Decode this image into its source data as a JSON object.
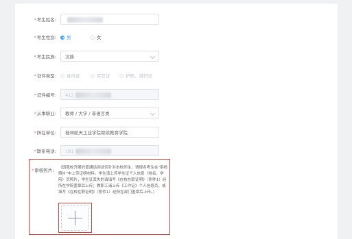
{
  "colors": {
    "required": "#f56c6c",
    "primary": "#409eff",
    "annotation": "#e03c31"
  },
  "form": {
    "name": {
      "label": "考生姓名:",
      "value": "",
      "required_mark": "*"
    },
    "gender": {
      "label": "考生性别:",
      "options": [
        "男",
        "女"
      ],
      "selected": "男"
    },
    "nation": {
      "label": "考生民族:",
      "value": "汉族"
    },
    "id_type": {
      "label": "证件类型:",
      "options": [
        "身份证",
        "军官证",
        "护照、港行证"
      ],
      "selected": "身份证"
    },
    "id_number": {
      "label": "证件编号:",
      "value": "412"
    },
    "occupation": {
      "label": "从事职业:",
      "value": "教师 / 大学 / 非语言类"
    },
    "workplace": {
      "label": "所在单位:",
      "value": "桂林航天工业学院继续教育学院"
    },
    "phone": {
      "label": "联系电话:",
      "value": "181"
    },
    "photo": {
      "label": "审核照片:",
      "hint": "（因我校开展的普通话测试仅针对本校师生，请报名考生在\"审核照片\"中上传证明材料。学生请上传学生证个人信息（姓名、学院）页照片，学生证丢失的请填写《在校在职证明》（附件1）经所在学院盖章后上传；教职工请上传《工作证》个人信息页，或填写《在校在职证明》（附件1）经所在部门盖章后上传。）",
      "upload_icon": "plus-icon"
    }
  }
}
